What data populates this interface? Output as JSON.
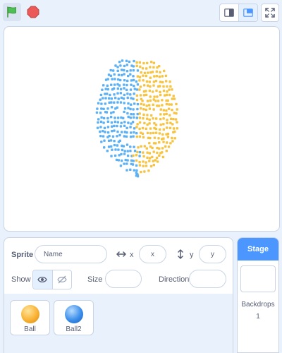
{
  "toolbar": {
    "green_flag_icon": "green-flag-icon",
    "stop_icon": "stop-sign-icon",
    "small_stage_icon": "small-stage-icon",
    "normal_stage_icon": "normal-stage-icon",
    "fullscreen_icon": "fullscreen-icon",
    "colors": {
      "flag": "#4cbf56",
      "stop": "#ec5959",
      "accent": "#4c97ff"
    }
  },
  "stage": {
    "content": "face-mesh point cloud",
    "colors": {
      "left_points": "#5cb1f5",
      "right_points": "#f7c441"
    }
  },
  "sprite_info": {
    "sprite_label": "Sprite",
    "name_placeholder": "Name",
    "x_label": "x",
    "x_placeholder": "x",
    "y_label": "y",
    "y_placeholder": "y",
    "show_label": "Show",
    "size_label": "Size",
    "size_value": "",
    "direction_label": "Direction",
    "direction_value": ""
  },
  "sprites": [
    {
      "name": "Ball",
      "color": "#f9b234"
    },
    {
      "name": "Ball2",
      "color": "#3b8eea"
    }
  ],
  "stage_pane": {
    "title": "Stage",
    "backdrops_label": "Backdrops",
    "backdrops_count": "1"
  }
}
